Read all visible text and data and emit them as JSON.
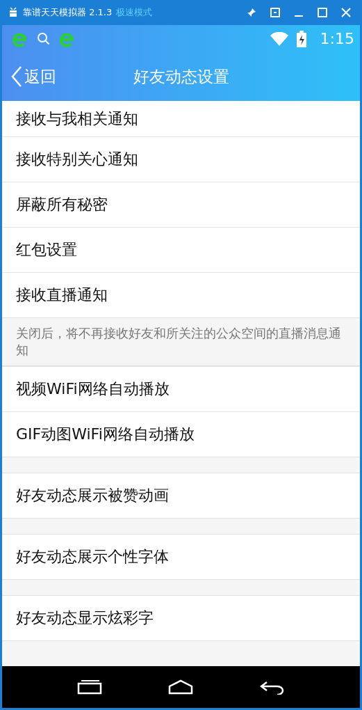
{
  "window": {
    "title": "靠谱天天模拟器 2.1.3",
    "mode": "极速模式"
  },
  "status_bar": {
    "time": "1:15"
  },
  "nav": {
    "back": "返回",
    "title": "好友动态设置"
  },
  "sections": [
    {
      "items": [
        "接收与我相关通知",
        "接收特别关心通知",
        "屏蔽所有秘密",
        "红包设置",
        "接收直播通知"
      ],
      "note": "关闭后，将不再接收好友和所关注的公众空间的直播消息通知"
    },
    {
      "items": [
        "视频WiFi网络自动播放",
        "GIF动图WiFi网络自动播放"
      ]
    },
    {
      "items": [
        "好友动态展示被赞动画"
      ]
    },
    {
      "items": [
        "好友动态展示个性字体"
      ]
    },
    {
      "items": [
        "好友动态显示炫彩字"
      ]
    }
  ]
}
